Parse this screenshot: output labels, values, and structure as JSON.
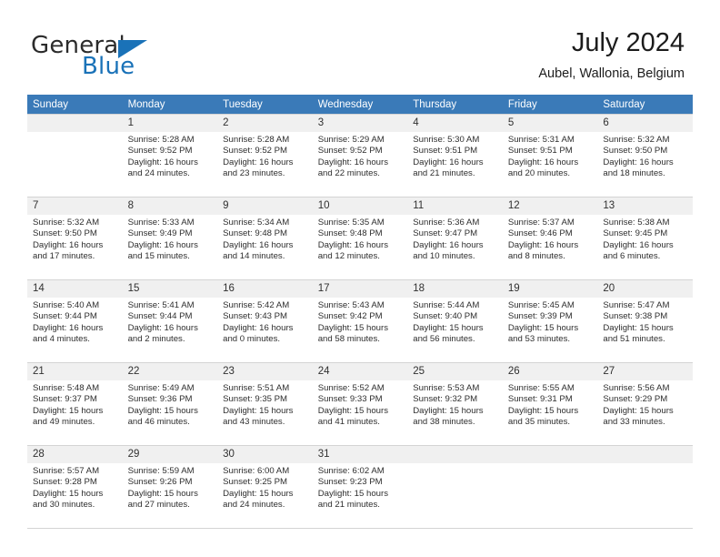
{
  "brand": {
    "word_one": "General",
    "word_two": "Blue",
    "logo_icon": "triangle-icon",
    "accent_color": "#1a72b8"
  },
  "header": {
    "title": "July 2024",
    "location": "Aubel, Wallonia, Belgium"
  },
  "calendar": {
    "header_background": "#3a7ab8",
    "daynum_background": "#f0f0f0",
    "weekday_headers": [
      "Sunday",
      "Monday",
      "Tuesday",
      "Wednesday",
      "Thursday",
      "Friday",
      "Saturday"
    ],
    "weeks": [
      [
        {
          "day": "",
          "sunrise": "",
          "sunset": "",
          "daylight_line1": "",
          "daylight_line2": ""
        },
        {
          "day": "1",
          "sunrise": "Sunrise: 5:28 AM",
          "sunset": "Sunset: 9:52 PM",
          "daylight_line1": "Daylight: 16 hours",
          "daylight_line2": "and 24 minutes."
        },
        {
          "day": "2",
          "sunrise": "Sunrise: 5:28 AM",
          "sunset": "Sunset: 9:52 PM",
          "daylight_line1": "Daylight: 16 hours",
          "daylight_line2": "and 23 minutes."
        },
        {
          "day": "3",
          "sunrise": "Sunrise: 5:29 AM",
          "sunset": "Sunset: 9:52 PM",
          "daylight_line1": "Daylight: 16 hours",
          "daylight_line2": "and 22 minutes."
        },
        {
          "day": "4",
          "sunrise": "Sunrise: 5:30 AM",
          "sunset": "Sunset: 9:51 PM",
          "daylight_line1": "Daylight: 16 hours",
          "daylight_line2": "and 21 minutes."
        },
        {
          "day": "5",
          "sunrise": "Sunrise: 5:31 AM",
          "sunset": "Sunset: 9:51 PM",
          "daylight_line1": "Daylight: 16 hours",
          "daylight_line2": "and 20 minutes."
        },
        {
          "day": "6",
          "sunrise": "Sunrise: 5:32 AM",
          "sunset": "Sunset: 9:50 PM",
          "daylight_line1": "Daylight: 16 hours",
          "daylight_line2": "and 18 minutes."
        }
      ],
      [
        {
          "day": "7",
          "sunrise": "Sunrise: 5:32 AM",
          "sunset": "Sunset: 9:50 PM",
          "daylight_line1": "Daylight: 16 hours",
          "daylight_line2": "and 17 minutes."
        },
        {
          "day": "8",
          "sunrise": "Sunrise: 5:33 AM",
          "sunset": "Sunset: 9:49 PM",
          "daylight_line1": "Daylight: 16 hours",
          "daylight_line2": "and 15 minutes."
        },
        {
          "day": "9",
          "sunrise": "Sunrise: 5:34 AM",
          "sunset": "Sunset: 9:48 PM",
          "daylight_line1": "Daylight: 16 hours",
          "daylight_line2": "and 14 minutes."
        },
        {
          "day": "10",
          "sunrise": "Sunrise: 5:35 AM",
          "sunset": "Sunset: 9:48 PM",
          "daylight_line1": "Daylight: 16 hours",
          "daylight_line2": "and 12 minutes."
        },
        {
          "day": "11",
          "sunrise": "Sunrise: 5:36 AM",
          "sunset": "Sunset: 9:47 PM",
          "daylight_line1": "Daylight: 16 hours",
          "daylight_line2": "and 10 minutes."
        },
        {
          "day": "12",
          "sunrise": "Sunrise: 5:37 AM",
          "sunset": "Sunset: 9:46 PM",
          "daylight_line1": "Daylight: 16 hours",
          "daylight_line2": "and 8 minutes."
        },
        {
          "day": "13",
          "sunrise": "Sunrise: 5:38 AM",
          "sunset": "Sunset: 9:45 PM",
          "daylight_line1": "Daylight: 16 hours",
          "daylight_line2": "and 6 minutes."
        }
      ],
      [
        {
          "day": "14",
          "sunrise": "Sunrise: 5:40 AM",
          "sunset": "Sunset: 9:44 PM",
          "daylight_line1": "Daylight: 16 hours",
          "daylight_line2": "and 4 minutes."
        },
        {
          "day": "15",
          "sunrise": "Sunrise: 5:41 AM",
          "sunset": "Sunset: 9:44 PM",
          "daylight_line1": "Daylight: 16 hours",
          "daylight_line2": "and 2 minutes."
        },
        {
          "day": "16",
          "sunrise": "Sunrise: 5:42 AM",
          "sunset": "Sunset: 9:43 PM",
          "daylight_line1": "Daylight: 16 hours",
          "daylight_line2": "and 0 minutes."
        },
        {
          "day": "17",
          "sunrise": "Sunrise: 5:43 AM",
          "sunset": "Sunset: 9:42 PM",
          "daylight_line1": "Daylight: 15 hours",
          "daylight_line2": "and 58 minutes."
        },
        {
          "day": "18",
          "sunrise": "Sunrise: 5:44 AM",
          "sunset": "Sunset: 9:40 PM",
          "daylight_line1": "Daylight: 15 hours",
          "daylight_line2": "and 56 minutes."
        },
        {
          "day": "19",
          "sunrise": "Sunrise: 5:45 AM",
          "sunset": "Sunset: 9:39 PM",
          "daylight_line1": "Daylight: 15 hours",
          "daylight_line2": "and 53 minutes."
        },
        {
          "day": "20",
          "sunrise": "Sunrise: 5:47 AM",
          "sunset": "Sunset: 9:38 PM",
          "daylight_line1": "Daylight: 15 hours",
          "daylight_line2": "and 51 minutes."
        }
      ],
      [
        {
          "day": "21",
          "sunrise": "Sunrise: 5:48 AM",
          "sunset": "Sunset: 9:37 PM",
          "daylight_line1": "Daylight: 15 hours",
          "daylight_line2": "and 49 minutes."
        },
        {
          "day": "22",
          "sunrise": "Sunrise: 5:49 AM",
          "sunset": "Sunset: 9:36 PM",
          "daylight_line1": "Daylight: 15 hours",
          "daylight_line2": "and 46 minutes."
        },
        {
          "day": "23",
          "sunrise": "Sunrise: 5:51 AM",
          "sunset": "Sunset: 9:35 PM",
          "daylight_line1": "Daylight: 15 hours",
          "daylight_line2": "and 43 minutes."
        },
        {
          "day": "24",
          "sunrise": "Sunrise: 5:52 AM",
          "sunset": "Sunset: 9:33 PM",
          "daylight_line1": "Daylight: 15 hours",
          "daylight_line2": "and 41 minutes."
        },
        {
          "day": "25",
          "sunrise": "Sunrise: 5:53 AM",
          "sunset": "Sunset: 9:32 PM",
          "daylight_line1": "Daylight: 15 hours",
          "daylight_line2": "and 38 minutes."
        },
        {
          "day": "26",
          "sunrise": "Sunrise: 5:55 AM",
          "sunset": "Sunset: 9:31 PM",
          "daylight_line1": "Daylight: 15 hours",
          "daylight_line2": "and 35 minutes."
        },
        {
          "day": "27",
          "sunrise": "Sunrise: 5:56 AM",
          "sunset": "Sunset: 9:29 PM",
          "daylight_line1": "Daylight: 15 hours",
          "daylight_line2": "and 33 minutes."
        }
      ],
      [
        {
          "day": "28",
          "sunrise": "Sunrise: 5:57 AM",
          "sunset": "Sunset: 9:28 PM",
          "daylight_line1": "Daylight: 15 hours",
          "daylight_line2": "and 30 minutes."
        },
        {
          "day": "29",
          "sunrise": "Sunrise: 5:59 AM",
          "sunset": "Sunset: 9:26 PM",
          "daylight_line1": "Daylight: 15 hours",
          "daylight_line2": "and 27 minutes."
        },
        {
          "day": "30",
          "sunrise": "Sunrise: 6:00 AM",
          "sunset": "Sunset: 9:25 PM",
          "daylight_line1": "Daylight: 15 hours",
          "daylight_line2": "and 24 minutes."
        },
        {
          "day": "31",
          "sunrise": "Sunrise: 6:02 AM",
          "sunset": "Sunset: 9:23 PM",
          "daylight_line1": "Daylight: 15 hours",
          "daylight_line2": "and 21 minutes."
        },
        {
          "day": "",
          "sunrise": "",
          "sunset": "",
          "daylight_line1": "",
          "daylight_line2": ""
        },
        {
          "day": "",
          "sunrise": "",
          "sunset": "",
          "daylight_line1": "",
          "daylight_line2": ""
        },
        {
          "day": "",
          "sunrise": "",
          "sunset": "",
          "daylight_line1": "",
          "daylight_line2": ""
        }
      ]
    ]
  }
}
